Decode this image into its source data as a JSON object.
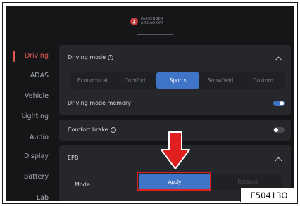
{
  "header": {
    "airbag_line1": "PASSENGER",
    "airbag_line2": "AIRBAG OFF"
  },
  "sidebar": {
    "items": [
      {
        "label": "Driving",
        "active": true
      },
      {
        "label": "ADAS",
        "active": false
      },
      {
        "label": "Vehicle",
        "active": false
      },
      {
        "label": "Lighting",
        "active": false
      },
      {
        "label": "Audio",
        "active": false
      },
      {
        "label": "Display",
        "active": false
      },
      {
        "label": "Battery",
        "active": false
      },
      {
        "label": "Lab",
        "active": false
      }
    ]
  },
  "driving_mode": {
    "title": "Driving mode",
    "options": [
      "Economical",
      "Comfort",
      "Sports",
      "Snowfield",
      "Custom"
    ],
    "selected": "Sports"
  },
  "memory": {
    "label": "Driving mode memory",
    "state": "on"
  },
  "comfort_brake": {
    "label": "Comfort brake",
    "state": "off"
  },
  "epb": {
    "title": "EPB",
    "mode_label": "Mode",
    "apply_label": "Apply",
    "release_label": "Release"
  },
  "figure_code": "E50413O",
  "colors": {
    "accent": "#3f74c6",
    "active_nav": "#e05a52",
    "highlight": "#e02020"
  }
}
